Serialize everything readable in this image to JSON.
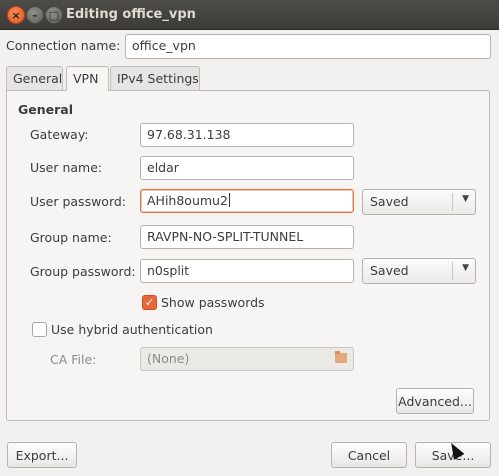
{
  "window": {
    "title": "Editing office_vpn",
    "close_glyph": "×",
    "min_glyph": "–",
    "max_glyph": "□"
  },
  "connection_name": {
    "label": "Connection name:",
    "value": "office_vpn"
  },
  "tabs": [
    {
      "label": "General"
    },
    {
      "label": "VPN"
    },
    {
      "label": "IPv4 Settings"
    }
  ],
  "vpn": {
    "section_title": "General",
    "gateway": {
      "label": "Gateway:",
      "value": "97.68.31.138"
    },
    "user_name": {
      "label": "User name:",
      "value": "eldar"
    },
    "user_password": {
      "label": "User password:",
      "value": "AHih8oumu2",
      "mode": "Saved"
    },
    "group_name": {
      "label": "Group name:",
      "value": "RAVPN-NO-SPLIT-TUNNEL"
    },
    "group_password": {
      "label": "Group password:",
      "value": "n0split",
      "mode": "Saved"
    },
    "show_passwords": {
      "label": "Show passwords",
      "checked": true
    },
    "hybrid_auth": {
      "label": "Use hybrid authentication",
      "checked": false
    },
    "ca_file": {
      "label": "CA File:",
      "value": "(None)"
    },
    "advanced_label": "Advanced..."
  },
  "footer": {
    "export_label": "Export...",
    "cancel_label": "Cancel",
    "save_label": "Save..."
  },
  "icons": {
    "checkmark": "✓",
    "dropdown": "▼"
  },
  "colors": {
    "accent": "#e8683a",
    "titlebar": "#3c3b37",
    "background": "#f2f1f0"
  }
}
